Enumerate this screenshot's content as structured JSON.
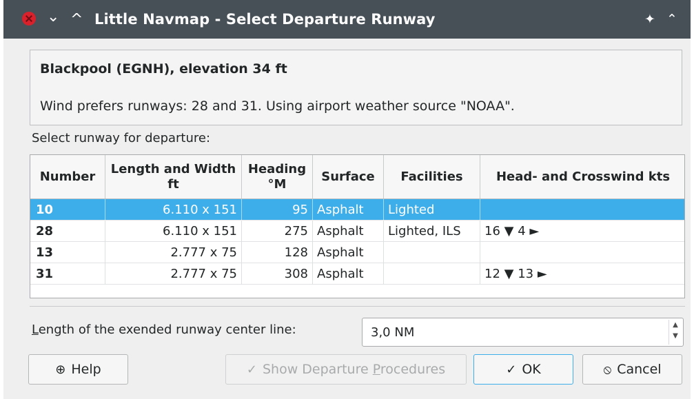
{
  "window": {
    "title": "Little Navmap - Select Departure Runway",
    "buttons": {
      "close_icon": "close-icon",
      "minimize_glyph": "⌄",
      "maximize_glyph": "^",
      "pin_glyph": "✦",
      "keep_above_glyph": "⌃"
    }
  },
  "info": {
    "title": "Blackpool (EGNH), elevation 34 ft",
    "wind_text": "Wind prefers runways: 28 and 31. Using airport weather source \"NOAA\"."
  },
  "select_label": "Select runway for departure:",
  "table": {
    "headers": [
      "Number",
      "Length and Width ft",
      "Heading °M",
      "Surface",
      "Facilities",
      "Head- and Crosswind kts"
    ],
    "rows": [
      {
        "number": "10",
        "length_width": "6.110 x 151",
        "heading": "95",
        "surface": "Asphalt",
        "facilities": "Lighted",
        "wind": "",
        "selected": true
      },
      {
        "number": "28",
        "length_width": "6.110 x 151",
        "heading": "275",
        "surface": "Asphalt",
        "facilities": "Lighted, ILS",
        "wind": "16 ▼ 4 ►",
        "selected": false
      },
      {
        "number": "13",
        "length_width": "2.777 x 75",
        "heading": "128",
        "surface": "Asphalt",
        "facilities": "",
        "wind": "",
        "selected": false
      },
      {
        "number": "31",
        "length_width": "2.777 x 75",
        "heading": "308",
        "surface": "Asphalt",
        "facilities": "",
        "wind": "12 ▼ 13 ►",
        "selected": false
      }
    ]
  },
  "extension": {
    "label_prefix": "L",
    "label_rest": "ength of the exended runway center line:",
    "value": "3,0 NM"
  },
  "buttons": {
    "help": {
      "label": "Help",
      "icon": "lifebuoy-icon"
    },
    "show_procedures": {
      "label_before": "Show Departure ",
      "label_accel": "P",
      "label_after": "rocedures",
      "icon": "check-icon"
    },
    "ok": {
      "label": "OK",
      "icon": "check-icon"
    },
    "cancel": {
      "label": "Cancel",
      "icon": "cancel-icon"
    }
  },
  "colors": {
    "titlebar": "#475057",
    "selection": "#3daee9",
    "close_button": "#d8212b",
    "dialog_background": "#efefef"
  }
}
